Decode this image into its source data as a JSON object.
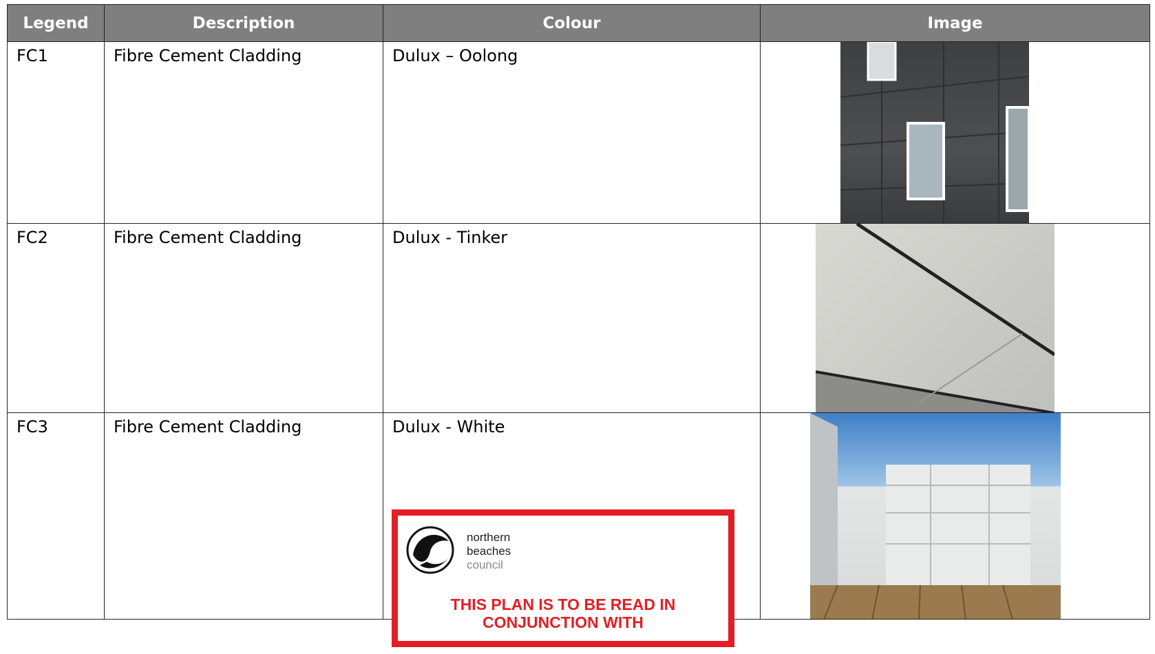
{
  "table": {
    "headers": [
      "Legend",
      "Description",
      "Colour",
      "Image"
    ],
    "rows": [
      {
        "legend": "FC1",
        "description": "Fibre Cement Cladding",
        "colour": "Dulux – Oolong"
      },
      {
        "legend": "FC2",
        "description": "Fibre Cement Cladding",
        "colour": "Dulux - Tinker"
      },
      {
        "legend": "FC3",
        "description": "Fibre Cement Cladding",
        "colour": "Dulux - White"
      }
    ]
  },
  "stamp": {
    "logo_lines": [
      "northern",
      "beaches",
      "council"
    ],
    "message_line1": "THIS PLAN IS TO BE READ IN",
    "message_line2": "CONJUNCTION WITH",
    "border_color": "#e31e24"
  },
  "colors": {
    "header_bg": "#7f7f7f",
    "header_text": "#ffffff"
  }
}
